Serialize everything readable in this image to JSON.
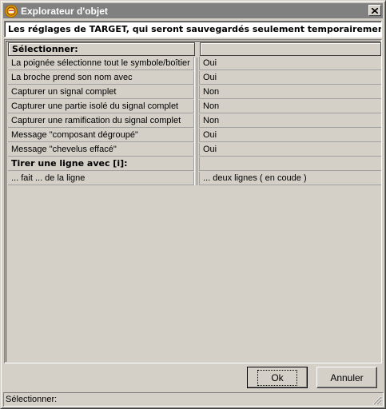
{
  "window": {
    "title": "Explorateur d'objet",
    "close_glyph": "✕"
  },
  "header": {
    "text": "Les réglages de TARGET, qui seront sauvegardés seulement temporairement"
  },
  "grid": {
    "column_header": {
      "label": "Sélectionner:",
      "value": ""
    },
    "rows": [
      {
        "label": "La poignée sélectionne tout le symbole/boîtier",
        "value": "Oui"
      },
      {
        "label": "La broche prend son nom avec",
        "value": "Oui"
      },
      {
        "label": "Capturer un signal complet",
        "value": "Non"
      },
      {
        "label": "Capturer une partie isolé du signal complet",
        "value": "Non"
      },
      {
        "label": "Capturer une ramification du signal complet",
        "value": "Non"
      },
      {
        "label": "Message \"composant dégroupé\"",
        "value": "Oui"
      },
      {
        "label": "Message \"chevelus effacé\"",
        "value": "Oui"
      }
    ],
    "section2": {
      "label": "Tirer une ligne avec [i]:",
      "value": ""
    },
    "rows2": [
      {
        "label": "... fait ... de la ligne",
        "value": "... deux lignes ( en coude )"
      }
    ]
  },
  "buttons": {
    "ok_label": "Ok",
    "cancel_label": "Annuler"
  },
  "statusbar": {
    "text": "Sélectionner:"
  },
  "icons": {
    "app": "app-logo-icon",
    "close": "close-icon",
    "grip": "resize-grip-icon"
  },
  "colors": {
    "titlebar": "#808080",
    "face": "#d4d0c8",
    "app_icon": "#e8a000"
  }
}
